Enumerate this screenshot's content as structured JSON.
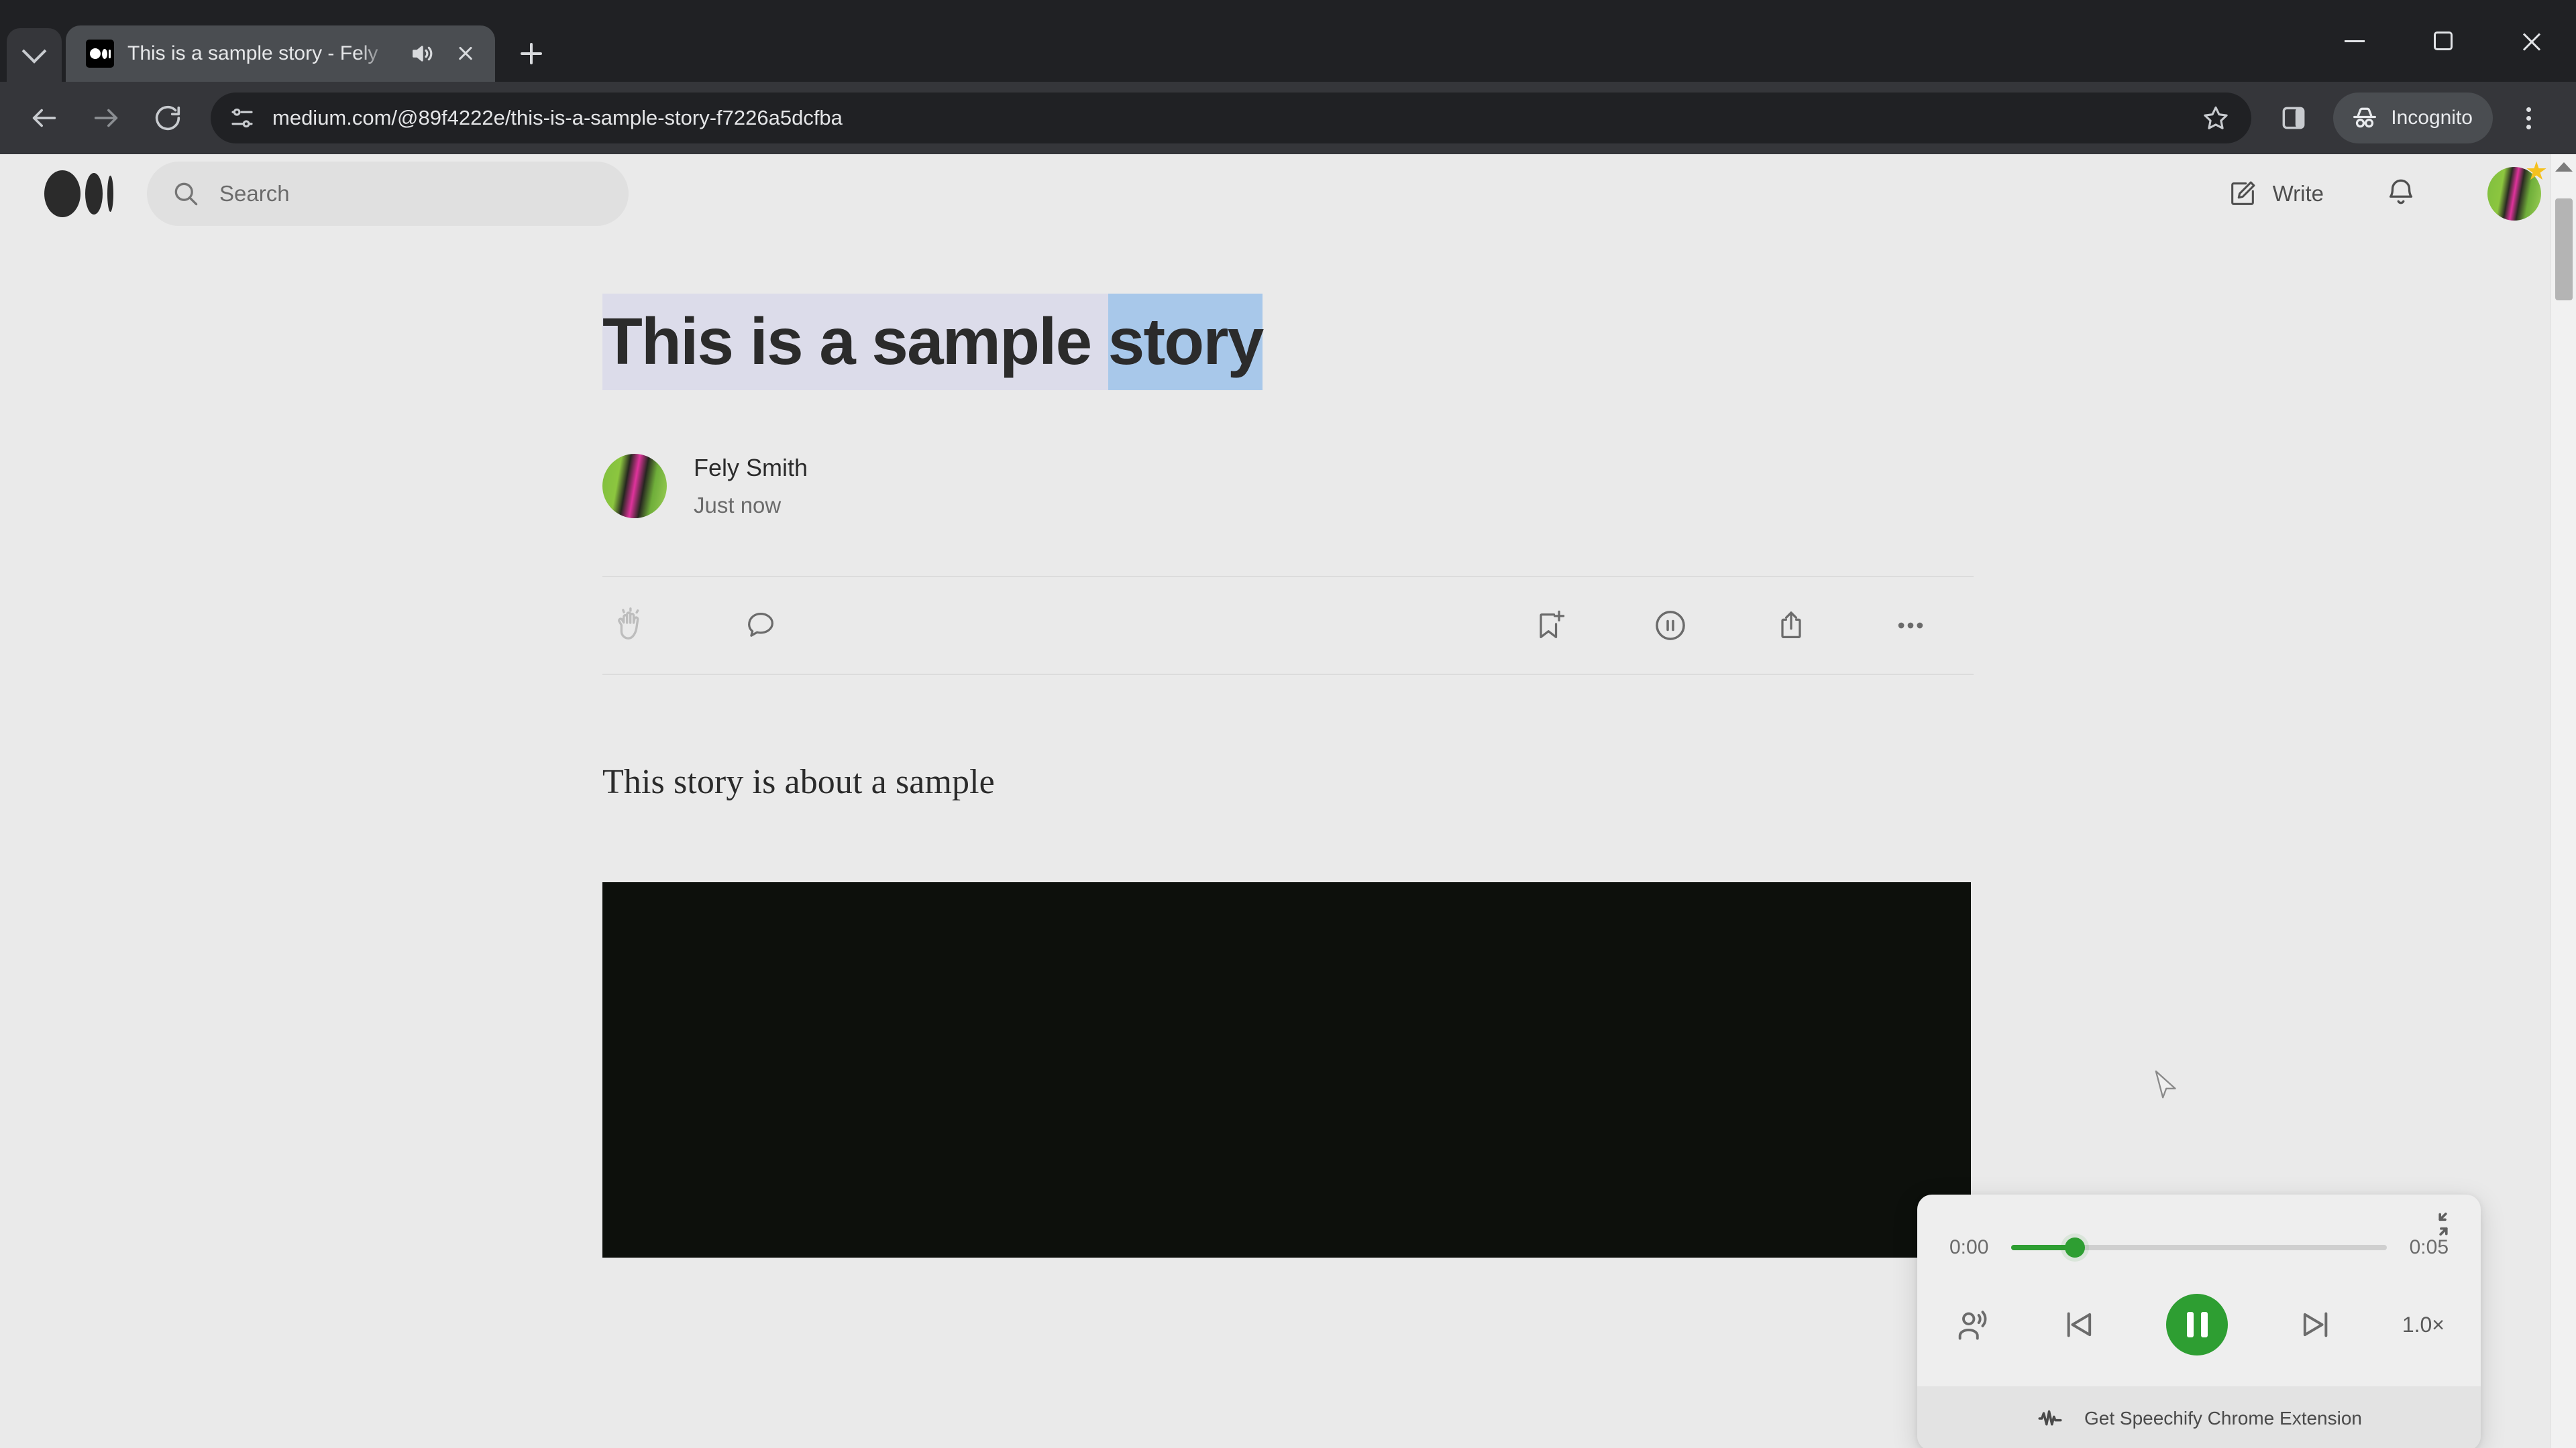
{
  "browser": {
    "tab": {
      "title": "This is a sample story - Fely",
      "favicon": "medium-logo-icon",
      "audio_icon": "speaker-playing-icon",
      "close_icon": "close-icon"
    },
    "tab_search_icon": "chevron-down-icon",
    "new_tab_icon": "plus-icon",
    "window_controls": {
      "minimize": "minimize-icon",
      "maximize": "maximize-restore-icon",
      "close": "close-icon"
    },
    "toolbar": {
      "back_icon": "back-arrow-icon",
      "forward_icon": "forward-arrow-icon",
      "reload_icon": "reload-icon",
      "site_info_icon": "site-settings-icon",
      "url": "medium.com/@89f4222e/this-is-a-sample-story-f7226a5dcfba",
      "bookmark_icon": "bookmark-star-icon",
      "side_panel_icon": "side-panel-icon",
      "incognito_label": "Incognito",
      "incognito_icon": "incognito-hat-icon",
      "menu_icon": "three-dot-menu-icon"
    }
  },
  "site": {
    "header": {
      "logo": "medium-logo-icon",
      "search_placeholder": "Search",
      "search_icon": "search-icon",
      "write_label": "Write",
      "write_icon": "write-pencil-icon",
      "notifications_icon": "bell-icon",
      "avatar": "user-avatar",
      "avatar_badge_icon": "star-badge-icon"
    },
    "article": {
      "title_read": "This is a sample ",
      "title_current_word": "story",
      "author": "Fely Smith",
      "timestamp": "Just now",
      "body": "This story is about a sample",
      "actions_left": [
        "clap-icon",
        "comment-icon"
      ],
      "actions_right": [
        "bookmark-add-icon",
        "listen-pause-icon",
        "share-icon",
        "more-options-icon"
      ]
    }
  },
  "speechify": {
    "collapse_icon": "collapse-arrows-icon",
    "current_time": "0:00",
    "total_time": "0:05",
    "progress_percent": 17,
    "voice_icon": "voice-person-icon",
    "previous_icon": "skip-previous-icon",
    "play_state_icon": "pause-icon",
    "next_icon": "skip-next-icon",
    "speed_label": "1.0×",
    "footer_icon": "speechify-waveform-icon",
    "footer_label": "Get Speechify Chrome Extension",
    "accent_color": "#2e9e32"
  },
  "cursor": {
    "icon": "arrow-cursor"
  }
}
